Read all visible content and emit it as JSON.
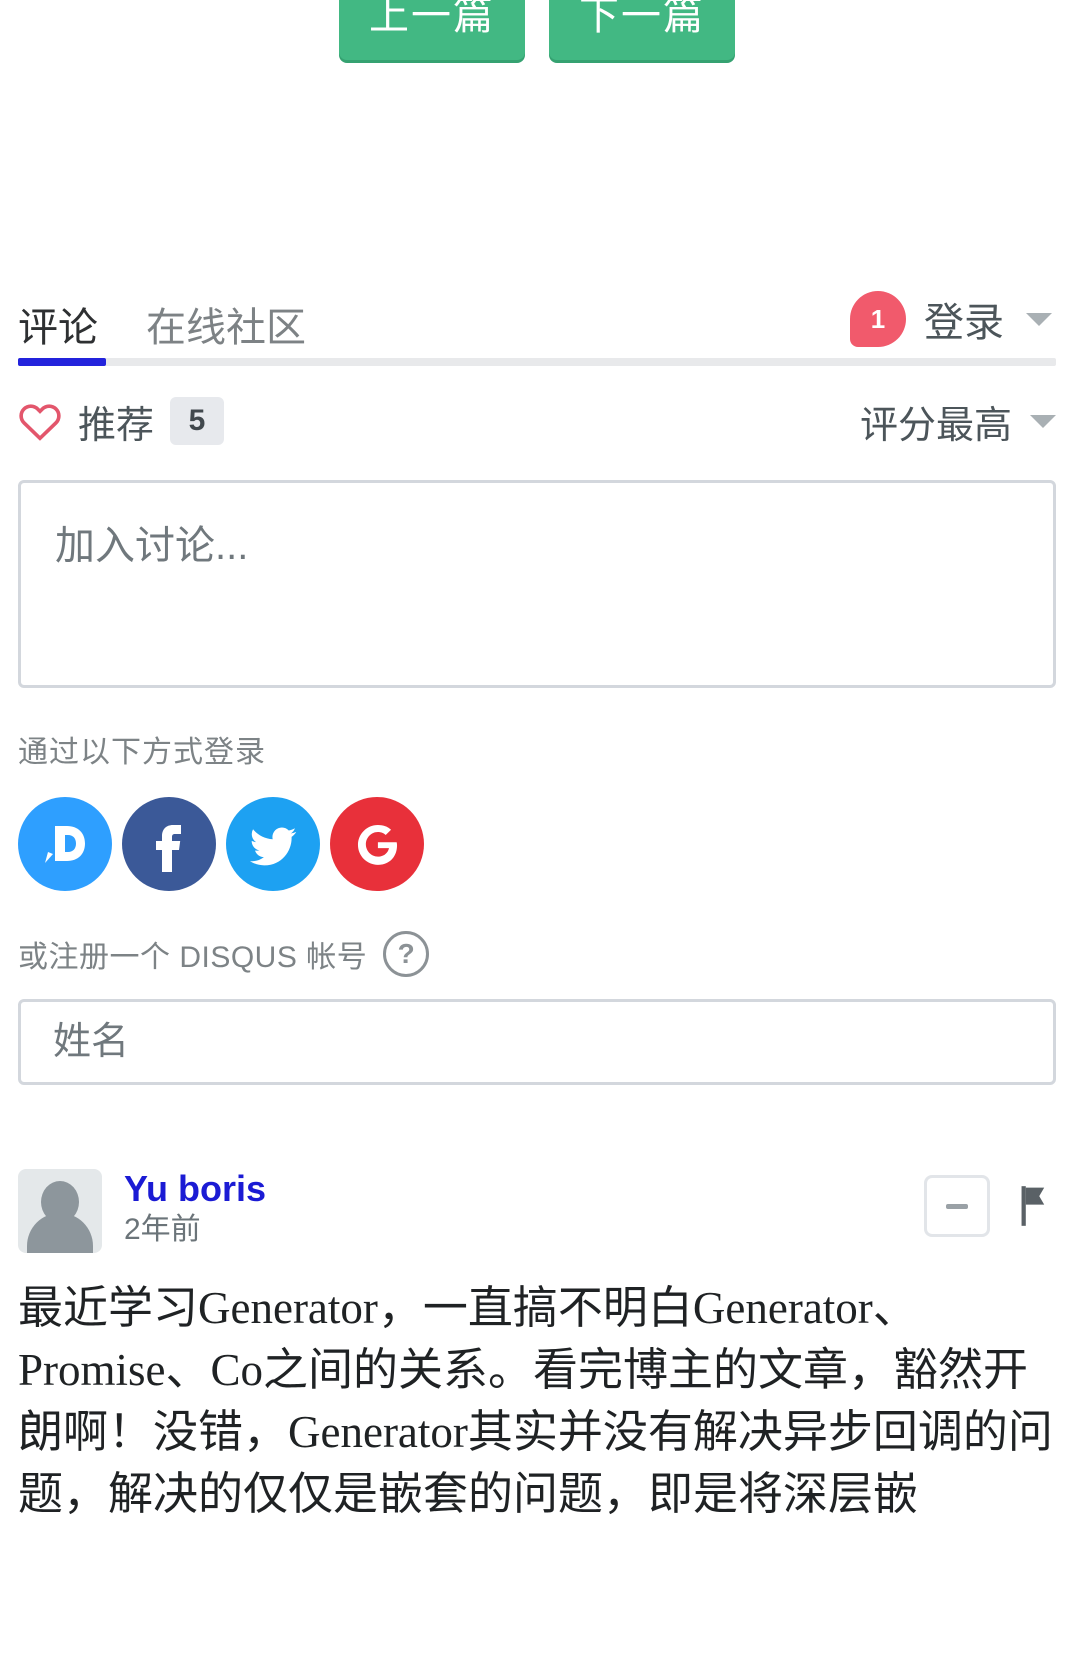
{
  "page_nav": {
    "prev_label": "上一篇",
    "next_label": "下一篇",
    "button_color": "#42b883"
  },
  "disqus": {
    "tabs": [
      {
        "label": "评论",
        "active": true
      },
      {
        "label": "在线社区",
        "active": false
      }
    ],
    "active_tab_color": "#2323dc",
    "login": {
      "badge_count": "1",
      "badge_color": "#f15a6c",
      "label": "登录",
      "caret": "chevron-down-icon"
    },
    "recommend": {
      "icon": "heart-icon",
      "icon_color": "#e3566c",
      "label": "推荐",
      "count": "5"
    },
    "sort": {
      "label": "评分最高",
      "caret": "chevron-down-icon"
    },
    "composer": {
      "placeholder": "加入讨论...",
      "value": ""
    },
    "login_with": {
      "label": "通过以下方式登录",
      "providers": [
        {
          "name": "disqus",
          "icon": "disqus-icon",
          "color": "#2e9fff",
          "glyph": "D"
        },
        {
          "name": "facebook",
          "icon": "facebook-icon",
          "color": "#3b5998",
          "glyph": "f"
        },
        {
          "name": "twitter",
          "icon": "twitter-icon",
          "color": "#1da1f2",
          "glyph": "bird"
        },
        {
          "name": "google",
          "icon": "google-icon",
          "color": "#e8303a",
          "glyph": "G"
        }
      ]
    },
    "signup": {
      "text": "或注册一个 DISQUS 帐号",
      "help_glyph": "?"
    },
    "name_field": {
      "placeholder": "姓名",
      "value": ""
    },
    "comments": [
      {
        "author": "Yu boris",
        "author_color": "#1b1bd4",
        "timestamp": "2年前",
        "avatar": "default-avatar-icon",
        "collapse_icon": "minus-icon",
        "flag_icon": "flag-icon",
        "body": "最近学习Generator，一直搞不明白Generator、Promise、Co之间的关系。看完博主的文章，豁然开朗啊！没错，Generator其实并没有解决异步回调的问题，解决的仅仅是嵌套的问题，即是将深层嵌"
      }
    ]
  }
}
